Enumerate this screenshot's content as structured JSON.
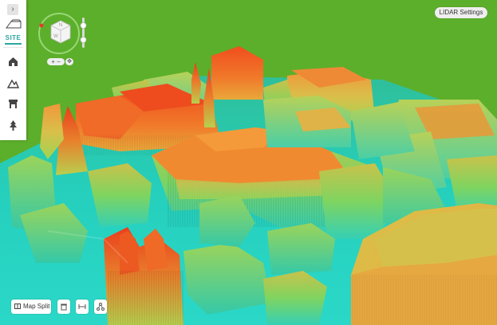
{
  "left_panel": {
    "collapse_icon": "chevron-right-icon",
    "collapse_glyph": "›",
    "active_tab_label": "SITE",
    "tools": [
      "home-icon",
      "terrain-icon",
      "building-icon",
      "tree-icon"
    ]
  },
  "navigation": {
    "cube_faces": [
      "N",
      "W"
    ],
    "zoom_label": "+ −",
    "pan_glyph": "✥"
  },
  "lidar_settings": {
    "label": "LIDAR Settings"
  },
  "bottom_toolbar": {
    "map_split_label": "Map Split",
    "tools": [
      "delete-icon",
      "ruler-icon",
      "share-icon"
    ]
  },
  "colors": {
    "ground_grass": "#5caf2a",
    "accent_teal": "#2aa7a0",
    "elevation_low": "#22d6c6",
    "elevation_mid": "#8fd24a",
    "elevation_high": "#ef4a20"
  }
}
